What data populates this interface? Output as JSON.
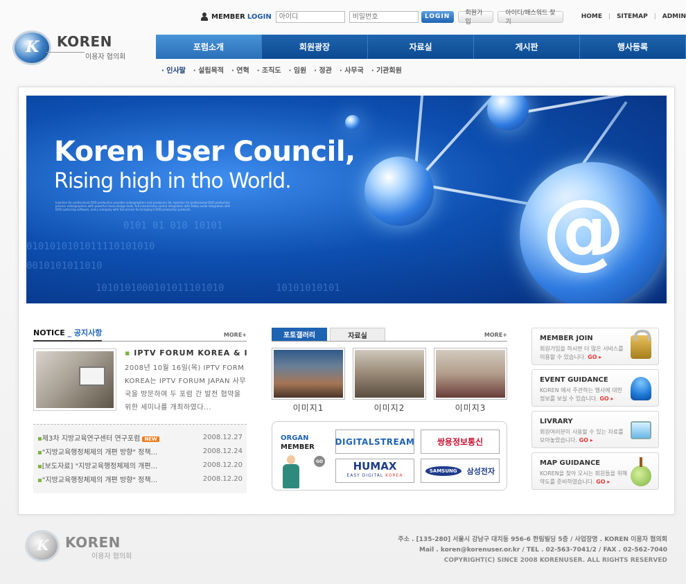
{
  "top": {
    "member_label": "MEMBER",
    "login_label": "LOGIN",
    "id_placeholder": "아이디",
    "pw_placeholder": "비밀번호",
    "login_button": "LOGIN",
    "join_button": "회원가입",
    "find_button": "아이디/패스워드 찾기",
    "links": [
      "HOME",
      "SITEMAP",
      "ADMIN"
    ]
  },
  "logo": {
    "mark": "K",
    "title": "KOREN",
    "subtitle": "이용자 협의회"
  },
  "nav": {
    "items": [
      "포럼소개",
      "회원광장",
      "자료실",
      "게시판",
      "행사등록"
    ],
    "sub_items": [
      "· 인사말",
      "· 설립목적",
      "· 연혁",
      "· 조직도",
      "· 임원",
      "· 정관",
      "· 사무국",
      "· 기관회원"
    ]
  },
  "banner": {
    "title": "Koren User Council,",
    "subtitle": "Rising high in tho World.",
    "fine_print": "Injection for professional DVD production provides videographers and producers 3d, injection for professional DVD production process videographers with powerful menu design tools, full interactivity control integration with Dolby audio integration with DVD-authoring software, and a company with full service for bringing it DVD production products.",
    "symbol": "@",
    "digits": [
      "0101010101011110101010",
      "0101 01 010 10101",
      "0010101011010",
      "1010101000101011101010",
      "10101010101"
    ]
  },
  "notice": {
    "title_en": "NOTICE",
    "title_ko": "_ 공지사항",
    "more": "MORE+",
    "feature_title": "IPTV FORUM KOREA & I...",
    "feature_body": "2008년 10월 16일(목) IPTV FORM KOREA는 IPTV FORUM JAPAN 사무국을 방문하여 두 포럼 간 발전 협약을 위한 세미나를 개최하였다...",
    "new_badge": "NEW",
    "rows": [
      {
        "title": "제3차 지방교육연구센터 연구포럼",
        "date": "2008.12.27"
      },
      {
        "title": "\"지방교육행정체제의 개편 방향\" 정책...",
        "date": "2008.12.24"
      },
      {
        "title": "[보도자료] \"지방교육행정체제의 개편...",
        "date": "2008.12.20"
      },
      {
        "title": "\"지방교육행정체제의 개편 방향\" 정책...",
        "date": "2008.12.20"
      }
    ]
  },
  "gallery": {
    "tabs": [
      "포토갤러리",
      "자료실"
    ],
    "more": "MORE+",
    "items": [
      "이미지1",
      "이미지2",
      "이미지3"
    ]
  },
  "organ": {
    "label_1": "ORGAN",
    "label_2": "MEMBER",
    "go": "GO",
    "partners": [
      "DIGITALSTREAM",
      "쌍용정보통신",
      "HUMAX",
      "EASY DIGITAL",
      "KOREA",
      "SAMSUNG",
      "삼성전자"
    ]
  },
  "cards": [
    {
      "title": "MEMBER JOIN",
      "desc": "회원가입을 하시면 더 많은 서비스를 이용할 수 있습니다.",
      "go": "GO ▸",
      "icon": "lock-icon"
    },
    {
      "title": "EVENT GUIDANCE",
      "desc": "KOREN 에서 주관하는 행사에 대한 정보를 보실 수 있습니다.",
      "go": "GO ▸",
      "icon": "people-icon"
    },
    {
      "title": "LIVRARY",
      "desc": "회원여러분이 사용할 수 있는 자료를 모아놓았습니다.",
      "go": "GO ▸",
      "icon": "monitor-icon"
    },
    {
      "title": "MAP GUIDANCE",
      "desc": "KOREN을 찾아 오시는 회원들을 위해 약도를 준비하였습니다.",
      "go": "GO ▸",
      "icon": "map-pin-icon"
    }
  ],
  "footer": {
    "address": "주소 . [135-280] 서울시 강남구 대치동 956-6 한림빌딩 5층 / 사업장명 . KOREN 이용자 협의회",
    "contact": "Mail . koren@korenuser.or.kr / TEL . 02-563-7041/2 / FAX . 02-562-7040",
    "copyright": "COPYRIGHT(C) SINCE 2008 KORENUSER. ALL RIGHTS RESERVED"
  }
}
